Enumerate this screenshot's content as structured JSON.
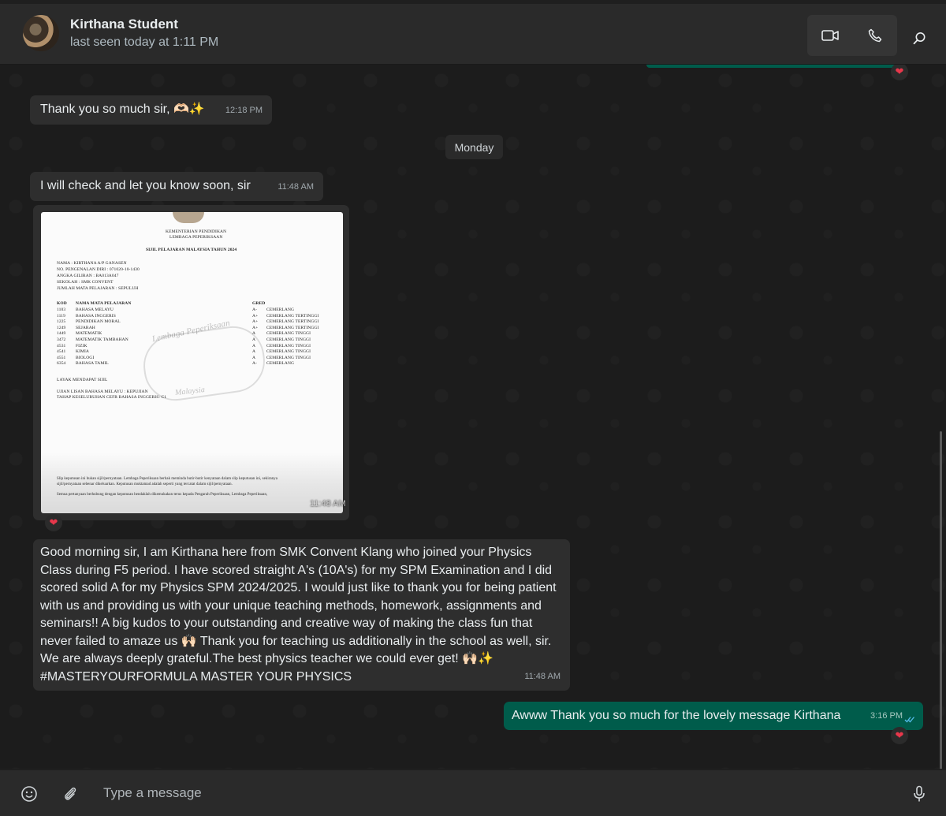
{
  "header": {
    "contact_name": "Kirthana Student",
    "status": "last seen today at 1:11 PM",
    "icons": [
      "video-call-icon",
      "voice-call-icon",
      "search-icon"
    ]
  },
  "messages": {
    "m1": {
      "text": "Thank you so much sir, 🫶🏻✨",
      "time": "12:18 PM"
    },
    "date_divider": "Monday",
    "m2": {
      "text": "I will check and let you know soon, sir",
      "time": "11:48 AM"
    },
    "m3": {
      "time": "11:48 AM",
      "doc": {
        "header1": "KEMENTERIAN PENDIDIKAN",
        "header2": "LEMBAGA PEPERIKSAAN",
        "title": "SIJIL PELAJARAN MALAYSIA TAHUN 2024",
        "nama": "NAMA : KIRTHANA A/P GANASEN",
        "ic": "NO. PENGENALAN DIRI : 071020-10-1430",
        "angka": "ANGKA GILIRAN : BA013A047",
        "sekolah": "SEKOLAH : SMK CONVENT",
        "jumlah": "JUMLAH MATA PELAJARAN : SEPULUH",
        "col_kod": "KOD",
        "col_nama": "NAMA MATA PELAJARAN",
        "col_gred": "GRED",
        "subjects": [
          {
            "kod": "1103",
            "nama": "BAHASA MELAYU",
            "gred": "A-",
            "desc": "CEMERLANG"
          },
          {
            "kod": "1119",
            "nama": "BAHASA INGGERIS",
            "gred": "A+",
            "desc": "CEMERLANG TERTINGGI"
          },
          {
            "kod": "1225",
            "nama": "PENDIDIKAN MORAL",
            "gred": "A+",
            "desc": "CEMERLANG TERTINGGI"
          },
          {
            "kod": "1249",
            "nama": "SEJARAH",
            "gred": "A+",
            "desc": "CEMERLANG TERTINGGI"
          },
          {
            "kod": "1449",
            "nama": "MATEMATIK",
            "gred": "A",
            "desc": "CEMERLANG TINGGI"
          },
          {
            "kod": "3472",
            "nama": "MATEMATIK TAMBAHAN",
            "gred": "A",
            "desc": "CEMERLANG TINGGI"
          },
          {
            "kod": "4531",
            "nama": "FIZIK",
            "gred": "A",
            "desc": "CEMERLANG TINGGI"
          },
          {
            "kod": "4541",
            "nama": "KIMIA",
            "gred": "A",
            "desc": "CEMERLANG TINGGI"
          },
          {
            "kod": "4551",
            "nama": "BIOLOGI",
            "gred": "A",
            "desc": "CEMERLANG TINGGI"
          },
          {
            "kod": "6354",
            "nama": "BAHASA TAMIL",
            "gred": "A-",
            "desc": "CEMERLANG"
          }
        ],
        "layak": "LAYAK MENDAPAT SIJIL",
        "lisan": "UJIAN LISAN BAHASA MELAYU : KEPUJIAN",
        "cefr": "TAHAP KESELURUHAN CEFR BAHASA INGGERIS: C1",
        "watermark1": "Lembaga Peperiksaan",
        "watermark2": "Malaysia",
        "footer1": "Slip keputusan ini bukan sijil/pernyataan. Lembaga Peperiksaan berhak meminda butir-butir kenyataan dalam slip keputusan ini, sekiranya",
        "footer2": "sijil/pernyataan sebenar dikeluarkan. Keputusan muktamad adalah seperti yang tercatat dalam sijil/pernyataan.",
        "footer3": "Semua pertanyaan berhubung dengan keputusan hendaklah dikemukakan terus kepada Pengarah Peperiksaan, Lembaga Peperiksaan,"
      }
    },
    "m4": {
      "text": "Good morning sir, I am Kirthana here from SMK Convent Klang who joined your Physics Class during F5 period. I have scored straight A's (10A's) for my SPM Examination and I did scored solid A for my Physics SPM 2024/2025. I would just like to thank you for being patient with us and providing us with your unique teaching methods, homework, assignments and seminars!! A big kudos to your outstanding and creative way of making the class fun that never failed to amaze us 🙌🏻 Thank you for teaching us additionally in the school as well, sir. We are always deeply grateful.The best physics teacher we could ever get! 🙌🏻✨ #MASTERYOURFORMULA MASTER YOUR PHYSICS",
      "time": "11:48 AM"
    },
    "m5": {
      "text": "Awww Thank you so much for the lovely message Kirthana",
      "time": "3:16 PM"
    },
    "reaction": "❤"
  },
  "composer": {
    "placeholder": "Type a message"
  }
}
